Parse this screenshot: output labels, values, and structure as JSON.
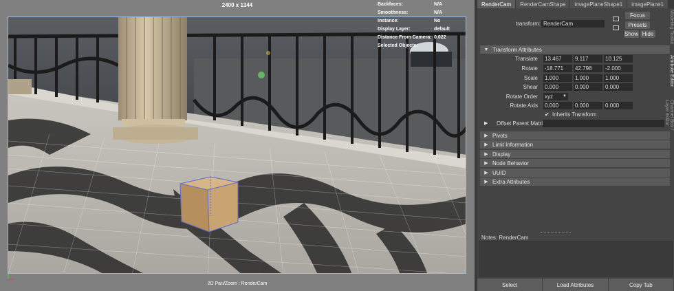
{
  "viewport": {
    "resolution": "2400 x 1344",
    "caption": "2D Pan/Zoom : RenderCam",
    "hud": [
      {
        "label": "Backfaces:",
        "value": "N/A"
      },
      {
        "label": "Smoothness:",
        "value": "N/A"
      },
      {
        "label": "Instance:",
        "value": "No"
      },
      {
        "label": "Display Layer:",
        "value": "default"
      },
      {
        "label": "Distance From Camera:",
        "value": "0.022"
      },
      {
        "label": "Selected Objects:",
        "value": ""
      }
    ]
  },
  "attribute_editor": {
    "tabs": [
      "RenderCam",
      "RenderCamShape",
      "imagePlaneShape1",
      "imagePlane1"
    ],
    "side_labels": [
      "Modeling Toolkit",
      "Attribute Editor",
      "Channel Box / Layer Editor"
    ],
    "transform_label": "transform:",
    "transform_value": "RenderCam",
    "buttons": {
      "focus": "Focus",
      "presets": "Presets",
      "show": "Show",
      "hide": "Hide"
    },
    "transform_section": "Transform Attributes",
    "translate": {
      "label": "Translate",
      "values": [
        "13.467",
        "9.117",
        "10.125"
      ]
    },
    "rotate": {
      "label": "Rotate",
      "values": [
        "-18.771",
        "42.798",
        "-2.000"
      ]
    },
    "scale": {
      "label": "Scale",
      "values": [
        "1.000",
        "1.000",
        "1.000"
      ]
    },
    "shear": {
      "label": "Shear",
      "values": [
        "0.000",
        "0.000",
        "0.000"
      ]
    },
    "rotate_order": {
      "label": "Rotate Order",
      "value": "xyz"
    },
    "rotate_axis": {
      "label": "Rotate Axis",
      "values": [
        "0.000",
        "0.000",
        "0.000"
      ]
    },
    "inherits_transform": {
      "label": "Inherits Transform",
      "checked": true,
      "mark": "✔"
    },
    "offset_parent": "Offset Parent Matrix",
    "collapsed_sections": [
      "Pivots",
      "Limit Information",
      "Display",
      "Node Behavior",
      "UUID",
      "Extra Attributes"
    ],
    "notes_label": "Notes:  RenderCam",
    "bottom_buttons": [
      "Select",
      "Load Attributes",
      "Copy Tab"
    ]
  },
  "colors": {
    "accent_selection": "#5c6bd6",
    "panel_bg": "#444444",
    "viewport_bg": "#808080"
  }
}
